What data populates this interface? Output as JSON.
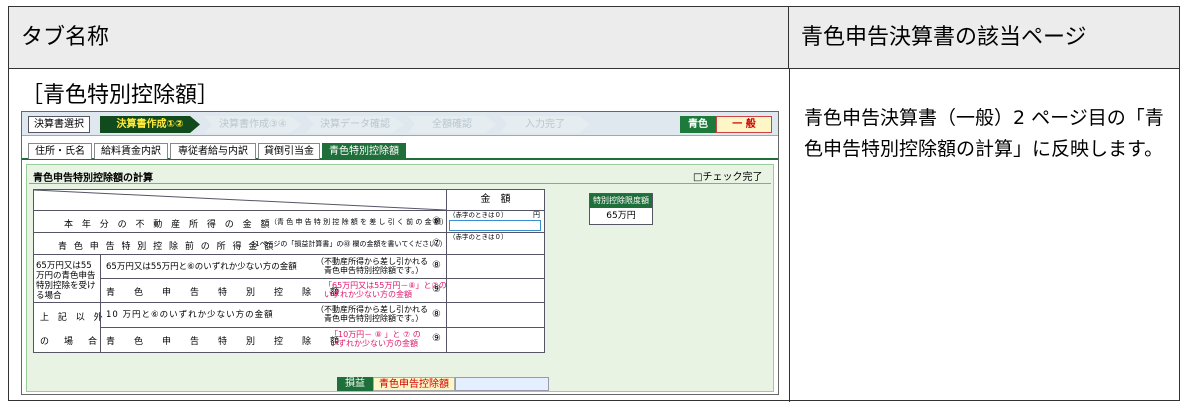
{
  "header": {
    "tab_name": "タブ名称",
    "page_ref": "青色申告決算書の該当ページ"
  },
  "section_label": "［青色特別控除額］",
  "description": "青色申告決算書（一般）2 ページ目の「青色申告特別控除額の計算」に反映します。",
  "app": {
    "select_button": "決算書選択",
    "steps": [
      "決算書作成①②",
      "決算書作成③④",
      "決算データ確認",
      "全額確認",
      "入力完了"
    ],
    "badge_blue": "青色",
    "badge_type": "一 般",
    "tabs": [
      "住所・氏名",
      "給料賃金内訳",
      "専従者給与内訳",
      "貸倒引当金",
      "青色特別控除額"
    ],
    "panel_title": "青色申告特別控除額の計算",
    "check_label": "□チェック完了",
    "amount_header": "金　額",
    "row6_label": "本 年 分 の 不 動 産 所 得 の 金 額",
    "row6_paren": "（青 色 申 告 特 別 控 除 額 を 差 し 引 く 前 の 金 額）",
    "row6_num": "⑥",
    "row6_hint": "（赤字のときは０）",
    "row6_unit": "円",
    "row7_label": "青 色 申 告 特 別 控 除 前 の 所 得 金 額",
    "row7_paren": "（1ページの「損益計算書」の㊸ 欄の金額を書いてください。）",
    "row7_num": "⑦",
    "row7_hint": "（赤字のときは０）",
    "group1_label": "65万円又は55万円の青色申告特別控除を受ける場合",
    "row8_label": "65万円又は55万円と⑥のいずれか少ない方の金額",
    "row8_paren1": "（不動産所得から差し引かれる",
    "row8_paren2": "　青色申告特別控除額です。）",
    "row8_num": "⑧",
    "row9_label": "青　色　申　告　特　別　控　除　額",
    "row9_paren1": "「65万円又は55万円－⑧」と⑦の",
    "row9_paren2": "いずれか少ない方の金額",
    "row9_num": "⑨",
    "group2_label1": "上 記 以 外",
    "group2_label2": "の　場　合",
    "row10_label": "10 万円と⑥のいずれか少ない方の金額",
    "row10_paren1": "（不動産所得から差し引かれる",
    "row10_paren2": "　青色申告特別控除額です。）",
    "row10_num": "⑧",
    "row11_label": "青　色　申　告　特　別　控　除　額",
    "row11_paren1": "「10万円－ ⑧ 」と ⑦ の",
    "row11_paren2": "いずれか少ない方の金額",
    "row11_num": "⑨",
    "limit_head": "特別控除限度額",
    "limit_value": "65万円",
    "bottom_label": "損益",
    "bottom_value": "青色申告控除額"
  }
}
